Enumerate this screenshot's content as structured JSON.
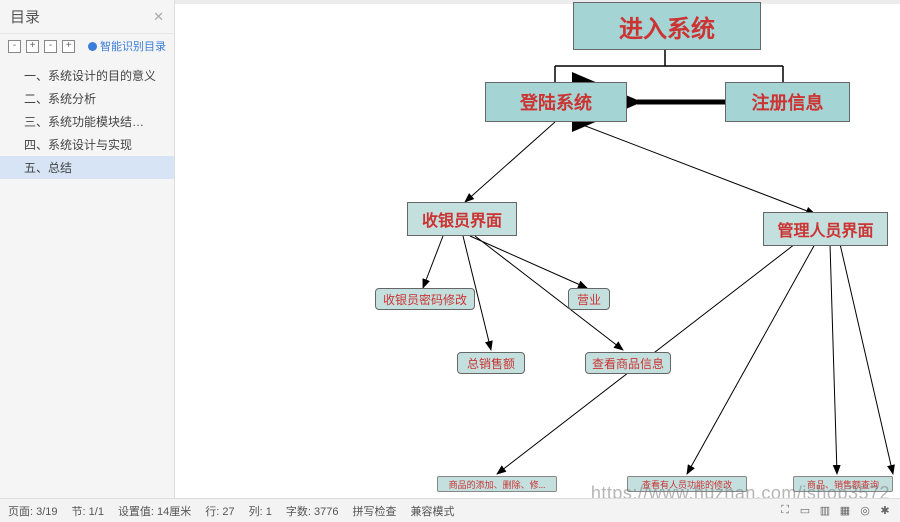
{
  "sidebar": {
    "title": "目录",
    "smart_toc": "智能识别目录",
    "items": [
      {
        "label": "一、系统设计的目的意义"
      },
      {
        "label": "二、系统分析"
      },
      {
        "label": "三、系统功能模块结构设 ..."
      },
      {
        "label": "四、系统设计与实现"
      },
      {
        "label": "五、总结"
      }
    ],
    "selected_index": 4
  },
  "diagram": {
    "nodes": {
      "root": "进入系统",
      "login": "登陆系统",
      "register": "注册信息",
      "cashier": "收银员界面",
      "admin": "管理人员界面",
      "pwd": "收银员密码修改",
      "biz": "营业",
      "sales": "总销售额",
      "goods": "查看商品信息",
      "bottom_left": "商品的添加、删除、修...",
      "bottom_mid": "查看有人员功能的修改",
      "bottom_right": "商品、销售额查询"
    }
  },
  "watermark": "https://www.huzhan.com/ishop3572",
  "statusbar": {
    "page": "页面: 3/19",
    "section": "节: 1/1",
    "ruler": "设置值: 14厘米",
    "row": "行: 27",
    "col": "列: 1",
    "chars": "字数: 3776",
    "spell": "拼写检查",
    "compat": "兼容模式"
  }
}
